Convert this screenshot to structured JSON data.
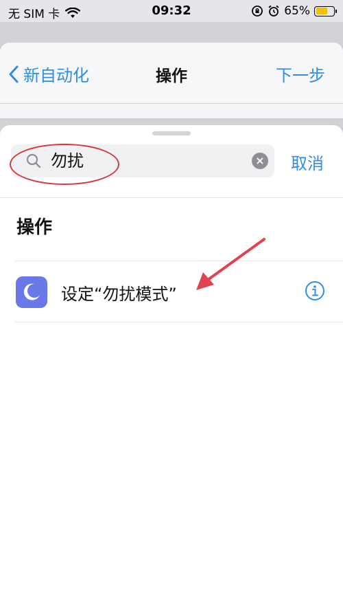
{
  "status_bar": {
    "carrier": "无 SIM 卡",
    "time": "09:32",
    "battery_percent": "65%",
    "battery_level": 0.65
  },
  "nav": {
    "back_label": "新自动化",
    "title": "操作",
    "next_label": "下一步"
  },
  "search": {
    "value": "勿扰",
    "cancel_label": "取消"
  },
  "section": {
    "title": "操作"
  },
  "actions": [
    {
      "label": "设定“勿扰模式”",
      "icon": "moon-icon"
    }
  ],
  "colors": {
    "accent": "#2d8ee3",
    "action_icon_bg": "#6b79e8",
    "annotation": "#e0424f",
    "battery": "#f2c200"
  }
}
